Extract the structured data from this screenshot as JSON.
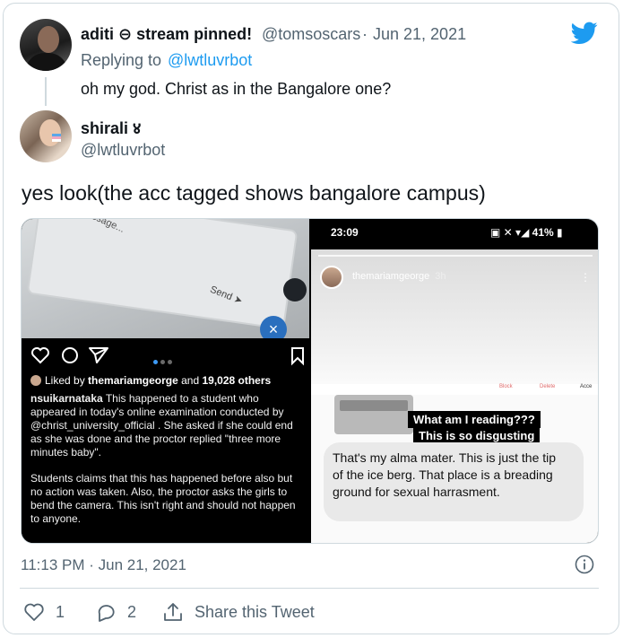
{
  "reply_tweet": {
    "display_name": "aditi ⊖ stream pinned!",
    "handle": "@tomsoscars",
    "separator": "·",
    "date": "Jun 21, 2021",
    "replying_prefix": "Replying to",
    "replying_handle": "@lwtluvrbot",
    "text": "oh my god. Christ as in the Bangalore one?"
  },
  "main_tweet": {
    "display_name": "shirali ४",
    "handle": "@lwtluvrbot",
    "text": "yes look(the acc tagged shows bangalore campus)",
    "timestamp": "11:13 PM · Jun 21, 2021",
    "like_count": "1",
    "reply_count": "2",
    "share_label": "Share this Tweet"
  },
  "media_left": {
    "photo_scribble": "Write a message...",
    "photo_send": "Send ➤",
    "likes_prefix": "Liked by",
    "likes_user": "themariamgeorge",
    "likes_and": "and",
    "likes_count": "19,028 others",
    "caption_user": "nsuikarnataka",
    "caption_p1": "This happened to a student who appeared in today's online examination conducted by @christ_university_official . She asked if she could end as she was done and the proctor replied \"three more minutes baby\".",
    "caption_p2": "Students claims that this has happened before also but no action was taken. Also, the proctor asks the girls to bend the camera. This isn't right and should not happen to anyone."
  },
  "media_right": {
    "status_time": "23:09",
    "status_right": "41%",
    "story_user": "themariamgeorge",
    "story_age": "3h",
    "strip_block": "Block",
    "strip_delete": "Delete",
    "strip_accept": "Acce",
    "overlay_line1": "What am I reading???",
    "overlay_line2": "This is so disgusting",
    "bubble_text": "That's my alma mater. This is just the tip of the ice berg. That place is a breading ground for sexual harrasment."
  },
  "colors": {
    "twitter_blue": "#1d9bf0",
    "muted_text": "#536471",
    "border": "#cfd9de"
  },
  "icons": [
    "twitter-bird-icon",
    "info-icon",
    "heart-icon",
    "reply-icon",
    "share-icon",
    "ig-heart-icon",
    "ig-comment-icon",
    "ig-send-icon",
    "ig-bookmark-icon"
  ]
}
